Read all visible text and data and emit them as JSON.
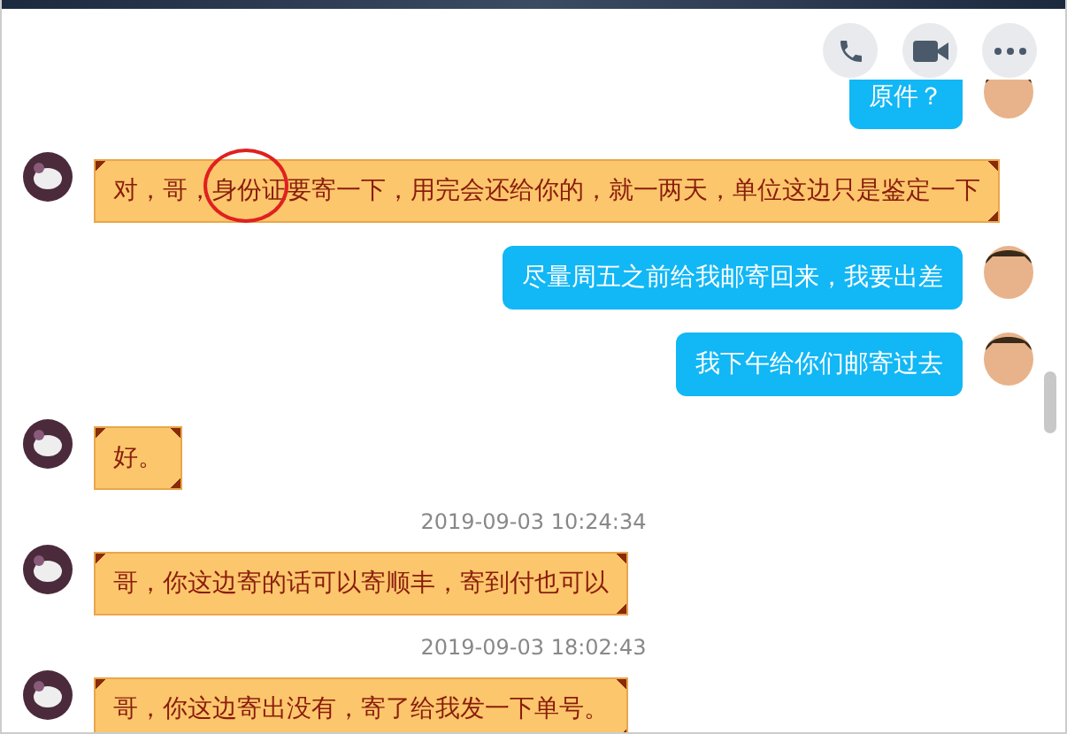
{
  "header": {
    "actions": [
      {
        "kind": "call"
      },
      {
        "kind": "video"
      },
      {
        "kind": "more"
      }
    ]
  },
  "messages": [
    {
      "kind": "sent",
      "text": "原件？",
      "highlighted": false
    },
    {
      "kind": "received",
      "text": "对，哥，身份证要寄一下，用完会还给你的，就一两天，单位这边只是鉴定一下",
      "highlighted": true
    },
    {
      "kind": "sent",
      "text": "尽量周五之前给我邮寄回来，我要出差",
      "highlighted": false
    },
    {
      "kind": "sent",
      "text": "我下午给你们邮寄过去",
      "highlighted": false
    },
    {
      "kind": "received",
      "text": "好。",
      "highlighted": false
    },
    {
      "kind": "timestamp",
      "text": "2019-09-03 10:24:34"
    },
    {
      "kind": "received",
      "text": "哥，你这边寄的话可以寄顺丰，寄到付也可以",
      "highlighted": false
    },
    {
      "kind": "timestamp",
      "text": "2019-09-03 18:02:43"
    },
    {
      "kind": "received",
      "text": "哥，你这边寄出没有，寄了给我发一下单号。",
      "highlighted": false
    }
  ]
}
